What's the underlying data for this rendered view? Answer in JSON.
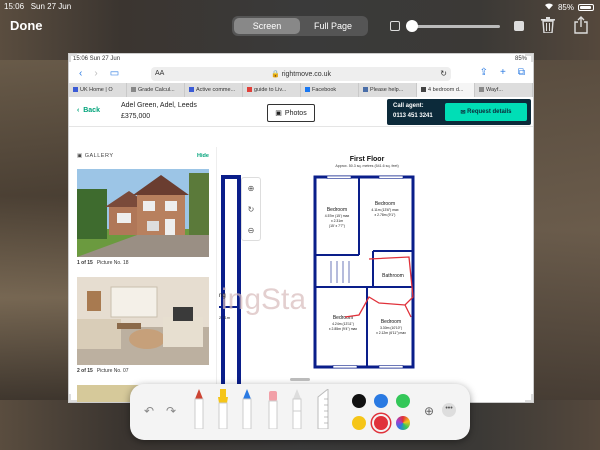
{
  "device_status": {
    "time": "15:06",
    "date": "Sun 27 Jun",
    "battery": "85%"
  },
  "toolbar": {
    "done_label": "Done",
    "segments": [
      {
        "label": "Screen",
        "active": true
      },
      {
        "label": "Full Page",
        "active": false
      }
    ],
    "opacity_value": 0.0
  },
  "screenshot": {
    "status": {
      "left": "15:06  Sun 27 Jun",
      "right": "85%"
    },
    "url": {
      "aa": "AA",
      "host": "rightmove.co.uk"
    },
    "tabs": [
      {
        "label": "UK Home | O",
        "color": "#3b5bd6"
      },
      {
        "label": "Grade Calcul...",
        "color": "#888888"
      },
      {
        "label": "Active comme...",
        "color": "#3b5bd6"
      },
      {
        "label": "guide to Liv...",
        "color": "#e0403a"
      },
      {
        "label": "Facebook",
        "color": "#1877f2"
      },
      {
        "label": "Please help...",
        "color": "#4a6ea8"
      },
      {
        "label": "4 bedroom d...",
        "color": "#444444",
        "active": true
      },
      {
        "label": "Wayf...",
        "color": "#888888"
      }
    ],
    "listing": {
      "back_label": "Back",
      "address": "Adel Green, Adel, Leeds",
      "price": "£375,000",
      "photos_button": "Photos",
      "call_agent_label": "Call agent:",
      "phone": "0113 451 3241",
      "request_details": "Request details"
    },
    "gallery": {
      "title": "GALLERY",
      "hide_label": "Hide",
      "photos": [
        {
          "index": "1 of 15",
          "caption": "Picture No. 18"
        },
        {
          "index": "2 of 15",
          "caption": "Picture No. 07"
        }
      ]
    },
    "floorplan": {
      "title": "First Floor",
      "subtitle": "Approx. 50.3 sq. metres (541.6 sq. feet)",
      "watermark": "ingSta",
      "rooms": [
        {
          "name": "Bedroom",
          "dims": "4.57m (15') max\nx 2.31m\n(15' x 7'7\")"
        },
        {
          "name": "Bedroom",
          "dims": "4.11m (13'6\") max\nx 2.78m (9'1\")"
        },
        {
          "name": "Bathroom",
          "dims": ""
        },
        {
          "name": "Bedroom",
          "dims": "4.24m (13'11\")\nx 2.85m (9'4\") max"
        },
        {
          "name": "Bedroom",
          "dims": "3.30m (10'10\")\nx 2.12m (6'11\") max"
        }
      ]
    }
  },
  "markup_colors": [
    "#111111",
    "#2a7ae2",
    "#34c759",
    "#f5c518",
    "#e0313a"
  ]
}
